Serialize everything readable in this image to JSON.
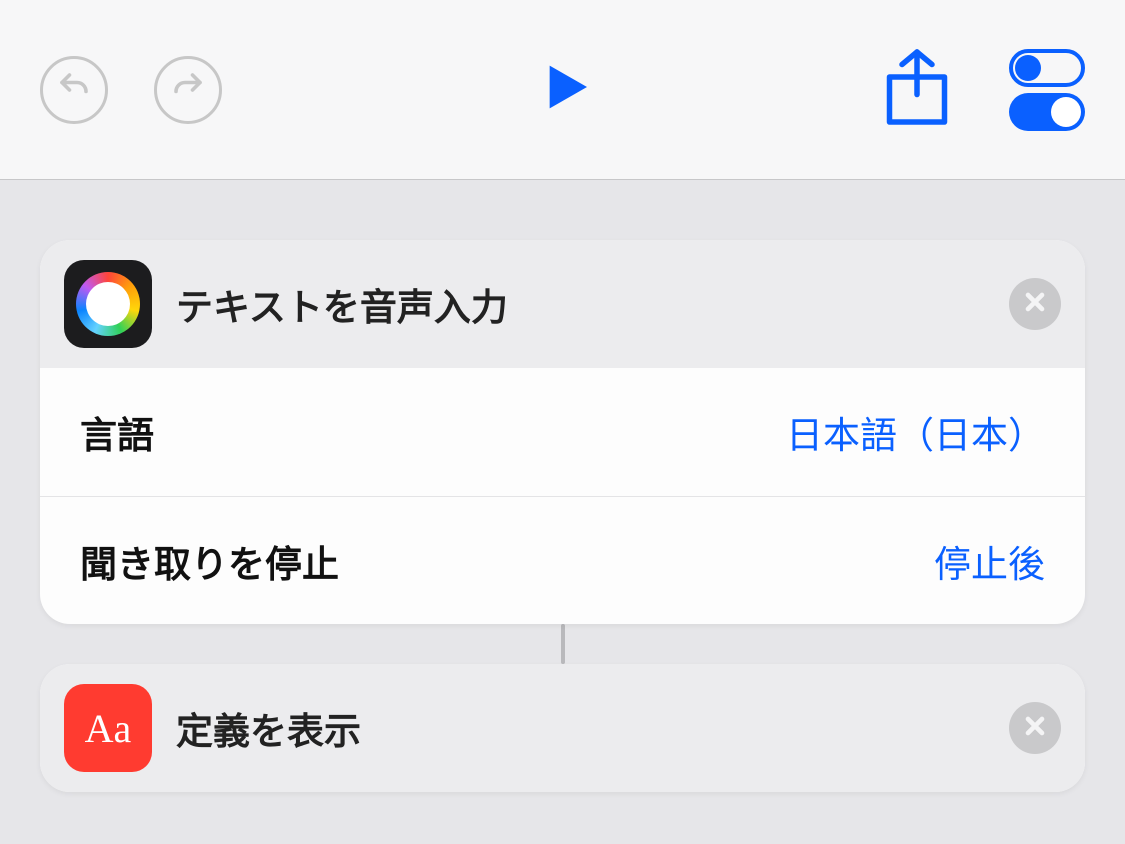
{
  "toolbar": {
    "undo": "undo",
    "redo": "redo",
    "play": "play",
    "share": "share",
    "settings": "settings"
  },
  "actions": [
    {
      "title": "テキストを音声入力",
      "params": [
        {
          "label": "言語",
          "value": "日本語（日本）"
        },
        {
          "label": "聞き取りを停止",
          "value": "停止後"
        }
      ]
    },
    {
      "title": "定義を表示"
    }
  ]
}
